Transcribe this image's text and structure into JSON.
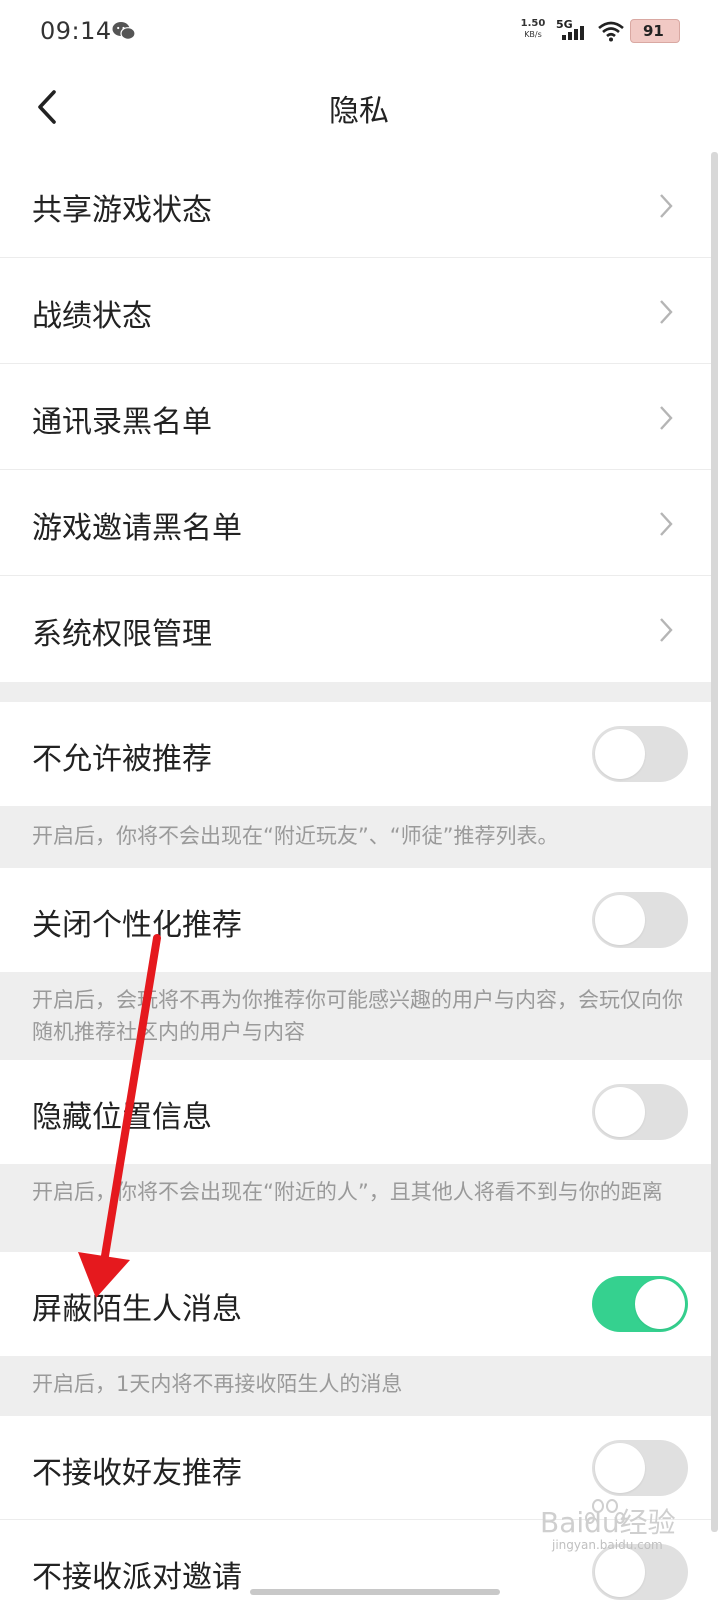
{
  "status_bar": {
    "time": "09:14",
    "net_speed_value": "1.50",
    "net_speed_unit": "KB/s",
    "network_type": "5G",
    "battery_level": "91",
    "icons": [
      "wechat-icon",
      "signal-icon",
      "wifi-icon",
      "battery-icon"
    ]
  },
  "nav": {
    "title": "隐私",
    "back_icon": "chevron-left-icon"
  },
  "link_items": [
    {
      "label": "共享游戏状态"
    },
    {
      "label": "战绩状态"
    },
    {
      "label": "通讯录黑名单"
    },
    {
      "label": "游戏邀请黑名单"
    },
    {
      "label": "系统权限管理"
    }
  ],
  "toggle_items": [
    {
      "label": "不允许被推荐",
      "enabled": false,
      "hint": "开启后，你将不会出现在“附近玩友”、“师徒”推荐列表。"
    },
    {
      "label": "关闭个性化推荐",
      "enabled": false,
      "hint": "开启后，会玩将不再为你推荐你可能感兴趣的用户与内容，会玩仅向你随机推荐社区内的用户与内容"
    },
    {
      "label": "隐藏位置信息",
      "enabled": false,
      "hint": "开启后，你将不会出现在“附近的人”，且其他人将看不到与你的距离"
    },
    {
      "label": "屏蔽陌生人消息",
      "enabled": true,
      "hint": "开启后，1天内将不再接收陌生人的消息"
    },
    {
      "label": "不接收好友推荐",
      "enabled": false
    },
    {
      "label": "不接收派对邀请",
      "enabled": false
    }
  ],
  "colors": {
    "toggle_on": "#35d18f",
    "toggle_off": "#e0e0e0",
    "annotation_arrow": "#e5191e",
    "hint_background": "#eeeeee"
  },
  "watermark": {
    "brand": "Baidu经验",
    "url": "jingyan.baidu.com"
  }
}
